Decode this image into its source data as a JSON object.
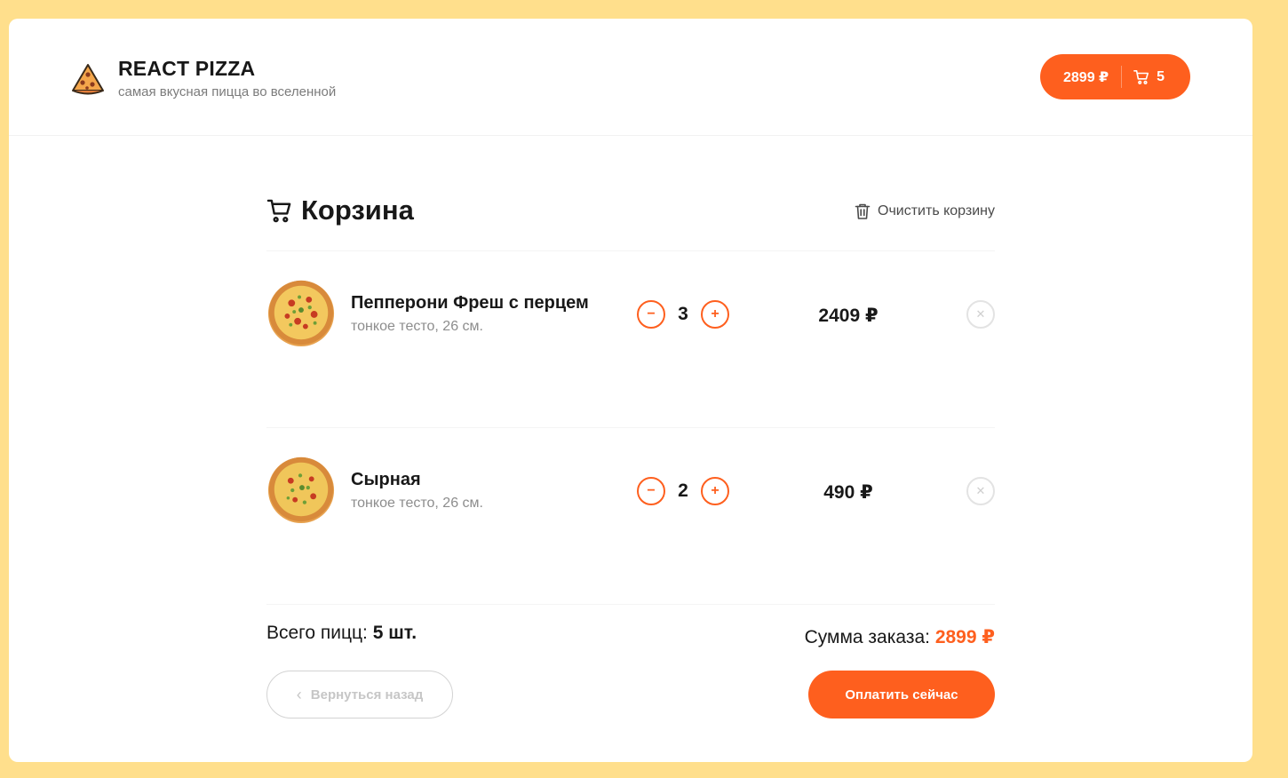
{
  "header": {
    "brand": "REACT PIZZA",
    "tagline": "самая вкусная пицца во вселенной",
    "cart_button": {
      "price": "2899 ₽",
      "count": "5"
    }
  },
  "cart": {
    "title": "Корзина",
    "clear_label": "Очистить корзину",
    "items": [
      {
        "name": "Пепперони Фреш с перцем",
        "desc": "тонкое тесто, 26 см.",
        "count": "3",
        "total": "2409 ₽",
        "minus": "−",
        "plus": "+",
        "remove": "✕"
      },
      {
        "name": "Сырная",
        "desc": "тонкое тесто, 26 см.",
        "count": "2",
        "total": "490 ₽",
        "minus": "−",
        "plus": "+",
        "remove": "✕"
      }
    ],
    "summary": {
      "total_pizzas_label": "Всего пицц:",
      "total_pizzas_value": "5 шт.",
      "order_sum_label": "Сумма заказа:",
      "order_sum_value": "2899 ₽"
    },
    "back_label": "Вернуться назад",
    "pay_label": "Оплатить сейчас"
  },
  "colors": {
    "background": "#FFDF8C",
    "accent": "#FE5F1E",
    "text": "#181818",
    "muted": "#8D8D8D"
  },
  "icons": [
    "pizza-logo-icon",
    "cart-icon",
    "trash-icon",
    "pizza-image",
    "chevron-left-icon",
    "close-icon"
  ]
}
